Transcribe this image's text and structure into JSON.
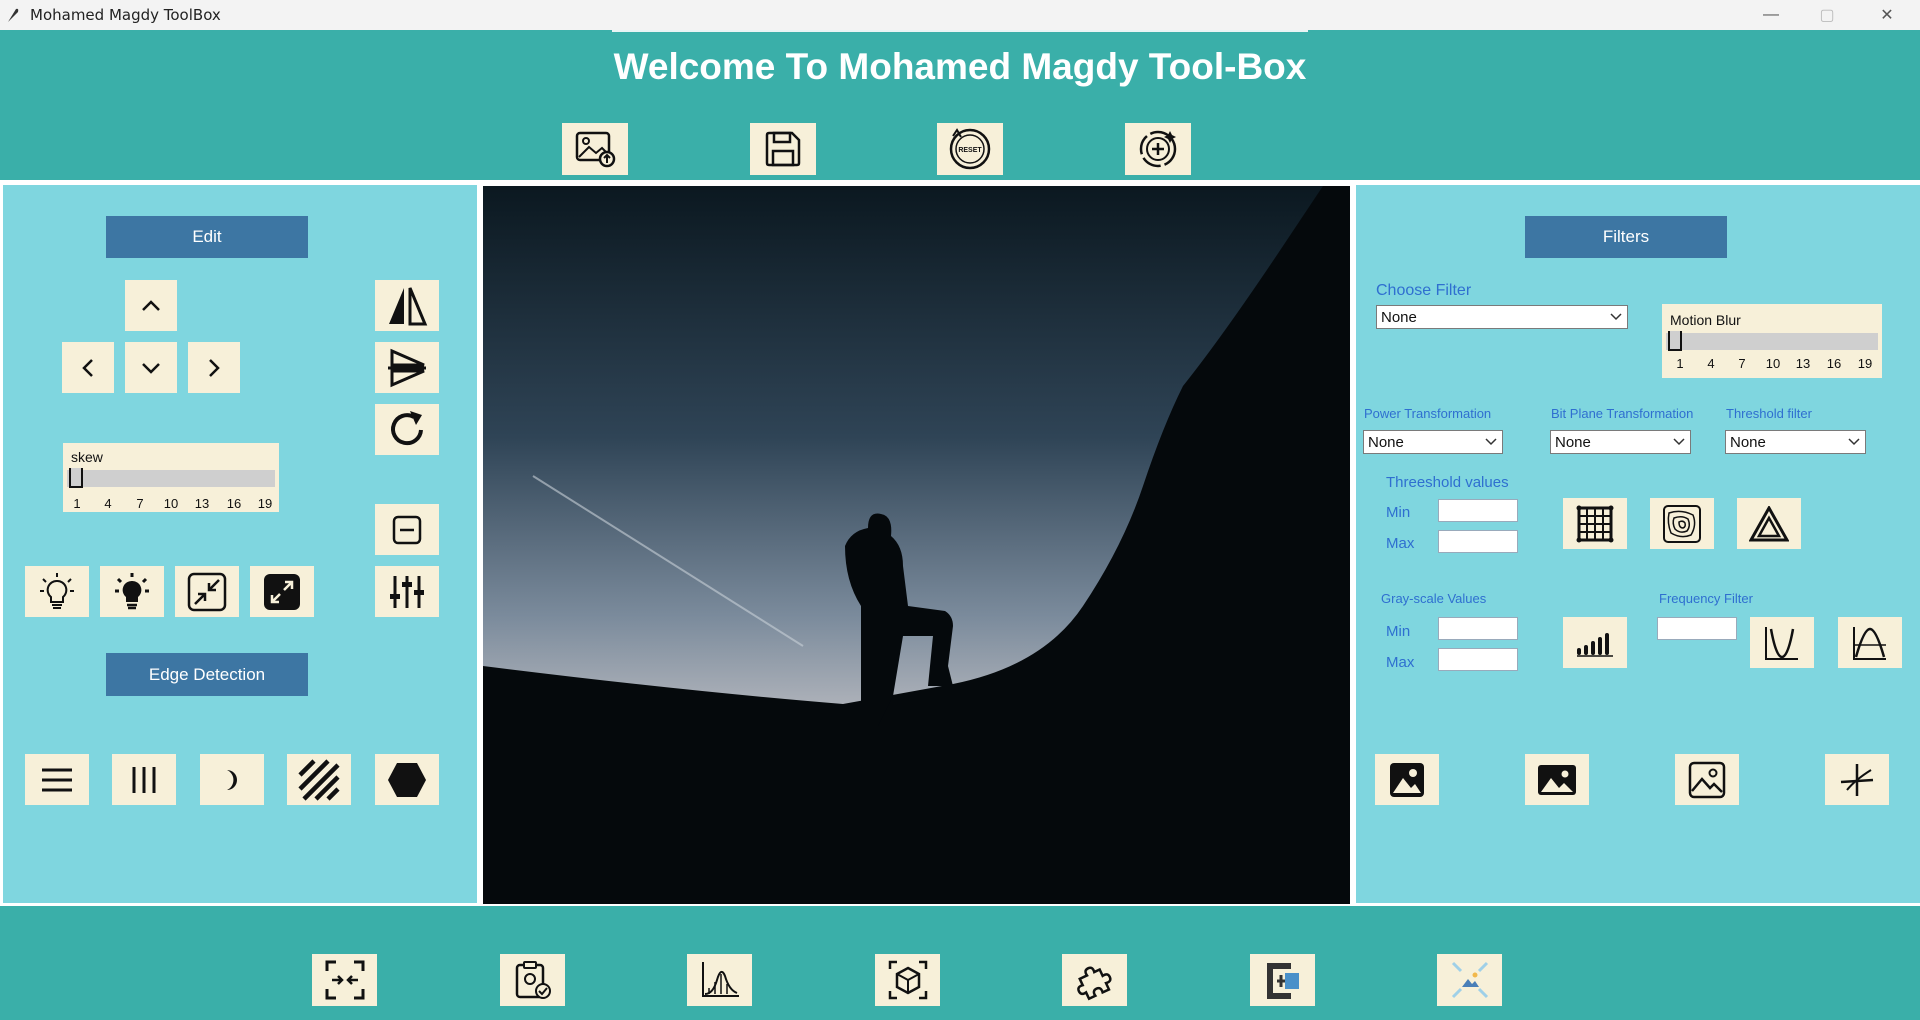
{
  "window": {
    "title": "Mohamed Magdy ToolBox",
    "minimize": "—",
    "maximize": "▢",
    "close": "✕"
  },
  "header": {
    "heading": "Welcome To Mohamed Magdy Tool-Box",
    "reset_icon_text": "RESET"
  },
  "left_panel": {
    "edit_label": "Edit",
    "skew": {
      "label": "skew",
      "ticks": [
        "1",
        "4",
        "7",
        "10",
        "13",
        "16",
        "19"
      ],
      "value": 1,
      "min": 1,
      "max": 20
    },
    "edge_label": "Edge Detection"
  },
  "right_panel": {
    "filters_label": "Filters",
    "choose_filter": {
      "label": "Choose Filter",
      "value": "None"
    },
    "motion_blur": {
      "label": "Motion Blur",
      "ticks": [
        "1",
        "4",
        "7",
        "10",
        "13",
        "16",
        "19"
      ],
      "value": 1,
      "min": 1,
      "max": 20
    },
    "power_transformation": {
      "label": "Power Transformation",
      "value": "None"
    },
    "bit_plane": {
      "label": "Bit Plane Transformation",
      "value": "None"
    },
    "threshold_filter": {
      "label": "Threshold filter",
      "value": "None"
    },
    "threshold_values": {
      "label": "Threeshold values",
      "min_label": "Min",
      "max_label": "Max",
      "min_value": "",
      "max_value": ""
    },
    "grayscale_values": {
      "label": "Gray-scale Values",
      "min_label": "Min",
      "max_label": "Max",
      "min_value": "",
      "max_value": ""
    },
    "frequency_filter": {
      "label": "Frequency Filter",
      "value": ""
    }
  },
  "colors": {
    "teal": "#3aafa9",
    "light_teal": "#7fd6df",
    "button_bg": "#f7f0d9",
    "label_btn": "#3d76a3",
    "blue_text": "#2f6fd0"
  }
}
